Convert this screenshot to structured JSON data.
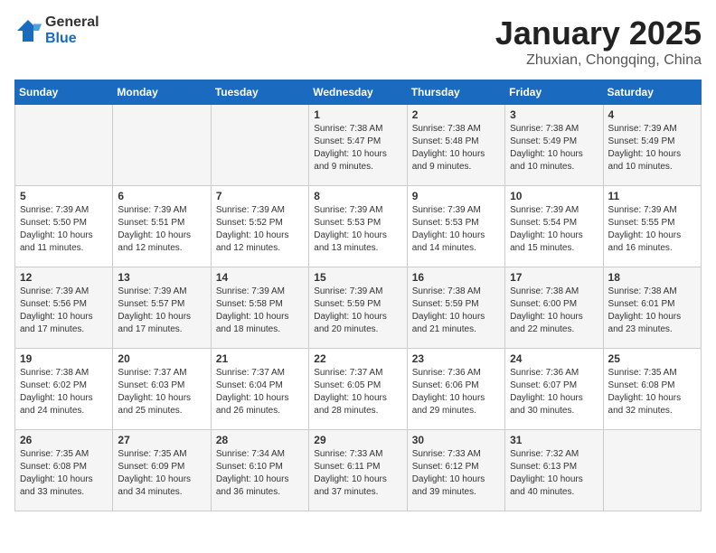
{
  "logo": {
    "general": "General",
    "blue": "Blue"
  },
  "title": "January 2025",
  "subtitle": "Zhuxian, Chongqing, China",
  "headers": [
    "Sunday",
    "Monday",
    "Tuesday",
    "Wednesday",
    "Thursday",
    "Friday",
    "Saturday"
  ],
  "weeks": [
    [
      {
        "day": "",
        "info": ""
      },
      {
        "day": "",
        "info": ""
      },
      {
        "day": "",
        "info": ""
      },
      {
        "day": "1",
        "info": "Sunrise: 7:38 AM\nSunset: 5:47 PM\nDaylight: 10 hours\nand 9 minutes."
      },
      {
        "day": "2",
        "info": "Sunrise: 7:38 AM\nSunset: 5:48 PM\nDaylight: 10 hours\nand 9 minutes."
      },
      {
        "day": "3",
        "info": "Sunrise: 7:38 AM\nSunset: 5:49 PM\nDaylight: 10 hours\nand 10 minutes."
      },
      {
        "day": "4",
        "info": "Sunrise: 7:39 AM\nSunset: 5:49 PM\nDaylight: 10 hours\nand 10 minutes."
      }
    ],
    [
      {
        "day": "5",
        "info": "Sunrise: 7:39 AM\nSunset: 5:50 PM\nDaylight: 10 hours\nand 11 minutes."
      },
      {
        "day": "6",
        "info": "Sunrise: 7:39 AM\nSunset: 5:51 PM\nDaylight: 10 hours\nand 12 minutes."
      },
      {
        "day": "7",
        "info": "Sunrise: 7:39 AM\nSunset: 5:52 PM\nDaylight: 10 hours\nand 12 minutes."
      },
      {
        "day": "8",
        "info": "Sunrise: 7:39 AM\nSunset: 5:53 PM\nDaylight: 10 hours\nand 13 minutes."
      },
      {
        "day": "9",
        "info": "Sunrise: 7:39 AM\nSunset: 5:53 PM\nDaylight: 10 hours\nand 14 minutes."
      },
      {
        "day": "10",
        "info": "Sunrise: 7:39 AM\nSunset: 5:54 PM\nDaylight: 10 hours\nand 15 minutes."
      },
      {
        "day": "11",
        "info": "Sunrise: 7:39 AM\nSunset: 5:55 PM\nDaylight: 10 hours\nand 16 minutes."
      }
    ],
    [
      {
        "day": "12",
        "info": "Sunrise: 7:39 AM\nSunset: 5:56 PM\nDaylight: 10 hours\nand 17 minutes."
      },
      {
        "day": "13",
        "info": "Sunrise: 7:39 AM\nSunset: 5:57 PM\nDaylight: 10 hours\nand 17 minutes."
      },
      {
        "day": "14",
        "info": "Sunrise: 7:39 AM\nSunset: 5:58 PM\nDaylight: 10 hours\nand 18 minutes."
      },
      {
        "day": "15",
        "info": "Sunrise: 7:39 AM\nSunset: 5:59 PM\nDaylight: 10 hours\nand 20 minutes."
      },
      {
        "day": "16",
        "info": "Sunrise: 7:38 AM\nSunset: 5:59 PM\nDaylight: 10 hours\nand 21 minutes."
      },
      {
        "day": "17",
        "info": "Sunrise: 7:38 AM\nSunset: 6:00 PM\nDaylight: 10 hours\nand 22 minutes."
      },
      {
        "day": "18",
        "info": "Sunrise: 7:38 AM\nSunset: 6:01 PM\nDaylight: 10 hours\nand 23 minutes."
      }
    ],
    [
      {
        "day": "19",
        "info": "Sunrise: 7:38 AM\nSunset: 6:02 PM\nDaylight: 10 hours\nand 24 minutes."
      },
      {
        "day": "20",
        "info": "Sunrise: 7:37 AM\nSunset: 6:03 PM\nDaylight: 10 hours\nand 25 minutes."
      },
      {
        "day": "21",
        "info": "Sunrise: 7:37 AM\nSunset: 6:04 PM\nDaylight: 10 hours\nand 26 minutes."
      },
      {
        "day": "22",
        "info": "Sunrise: 7:37 AM\nSunset: 6:05 PM\nDaylight: 10 hours\nand 28 minutes."
      },
      {
        "day": "23",
        "info": "Sunrise: 7:36 AM\nSunset: 6:06 PM\nDaylight: 10 hours\nand 29 minutes."
      },
      {
        "day": "24",
        "info": "Sunrise: 7:36 AM\nSunset: 6:07 PM\nDaylight: 10 hours\nand 30 minutes."
      },
      {
        "day": "25",
        "info": "Sunrise: 7:35 AM\nSunset: 6:08 PM\nDaylight: 10 hours\nand 32 minutes."
      }
    ],
    [
      {
        "day": "26",
        "info": "Sunrise: 7:35 AM\nSunset: 6:08 PM\nDaylight: 10 hours\nand 33 minutes."
      },
      {
        "day": "27",
        "info": "Sunrise: 7:35 AM\nSunset: 6:09 PM\nDaylight: 10 hours\nand 34 minutes."
      },
      {
        "day": "28",
        "info": "Sunrise: 7:34 AM\nSunset: 6:10 PM\nDaylight: 10 hours\nand 36 minutes."
      },
      {
        "day": "29",
        "info": "Sunrise: 7:33 AM\nSunset: 6:11 PM\nDaylight: 10 hours\nand 37 minutes."
      },
      {
        "day": "30",
        "info": "Sunrise: 7:33 AM\nSunset: 6:12 PM\nDaylight: 10 hours\nand 39 minutes."
      },
      {
        "day": "31",
        "info": "Sunrise: 7:32 AM\nSunset: 6:13 PM\nDaylight: 10 hours\nand 40 minutes."
      },
      {
        "day": "",
        "info": ""
      }
    ]
  ]
}
